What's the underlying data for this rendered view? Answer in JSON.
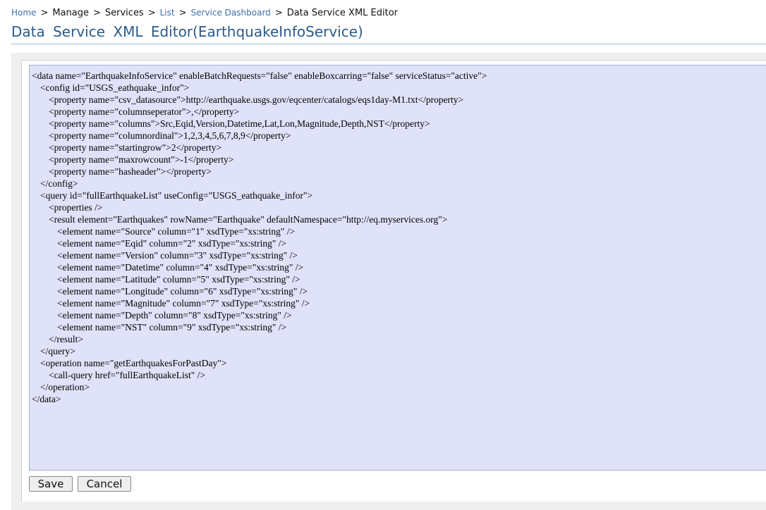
{
  "breadcrumb": {
    "home": "Home",
    "manage": "Manage",
    "services": "Services",
    "list": "List",
    "dashboard": "Service Dashboard",
    "current": "Data Service XML Editor",
    "separator": ">"
  },
  "page": {
    "title": "Data Service XML Editor(EarthquakeInfoService)"
  },
  "editor": {
    "lines": [
      "<data name=\"EarthquakeInfoService\" enableBatchRequests=\"false\" enableBoxcarring=\"false\" serviceStatus=\"active\">",
      "<config id=\"USGS_eathquake_infor\">",
      "<property name=\"csv_datasource\">http://earthquake.usgs.gov/eqcenter/catalogs/eqs1day-M1.txt</property>",
      "<property name=\"columnseperator\">,</property>",
      "<property name=\"columns\">Src,Eqid,Version,Datetime,Lat,Lon,Magnitude,Depth,NST</property>",
      "<property name=\"columnordinal\">1,2,3,4,5,6,7,8,9</property>",
      "<property name=\"startingrow\">2</property>",
      "<property name=\"maxrowcount\">-1</property>",
      "<property name=\"hasheader\"></property>",
      "</config>",
      "<query id=\"fullEarthquakeList\" useConfig=\"USGS_eathquake_infor\">",
      "<properties />",
      "<result element=\"Earthquakes\" rowName=\"Earthquake\" defaultNamespace=\"http://eq.myservices.org\">",
      "<element name=\"Source\" column=\"1\" xsdType=\"xs:string\" />",
      "<element name=\"Eqid\" column=\"2\" xsdType=\"xs:string\" />",
      "<element name=\"Version\" column=\"3\" xsdType=\"xs:string\" />",
      "<element name=\"Datetime\" column=\"4\" xsdType=\"xs:string\" />",
      "<element name=\"Latitude\" column=\"5\" xsdType=\"xs:string\" />",
      "<element name=\"Longitude\" column=\"6\" xsdType=\"xs:string\" />",
      "<element name=\"Magnitude\" column=\"7\" xsdType=\"xs:string\" />",
      "<element name=\"Depth\" column=\"8\" xsdType=\"xs:string\" />",
      "<element name=\"NST\" column=\"9\" xsdType=\"xs:string\" />",
      "</result>",
      "</query>",
      "<operation name=\"getEarthquakesForPastDay\">",
      "<call-query href=\"fullEarthquakeList\" />",
      "</operation>",
      "</data>"
    ]
  },
  "actions": {
    "save": "Save",
    "cancel": "Cancel"
  }
}
